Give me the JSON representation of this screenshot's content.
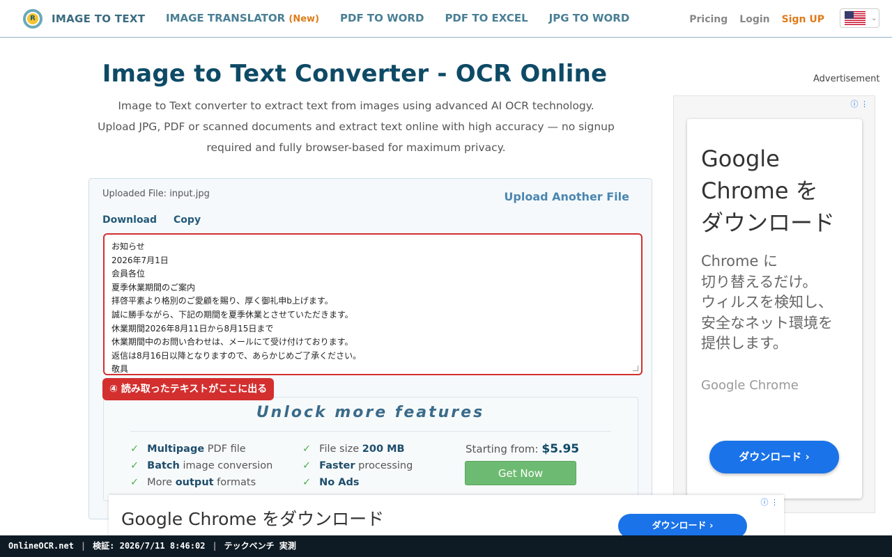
{
  "header": {
    "logo_text": "IMAGE TO TEXT",
    "nav": [
      {
        "label": "IMAGE TRANSLATOR",
        "tag": "(New)"
      },
      {
        "label": "PDF TO WORD"
      },
      {
        "label": "PDF TO EXCEL"
      },
      {
        "label": "JPG TO WORD"
      }
    ],
    "pricing": "Pricing",
    "login": "Login",
    "signup": "Sign UP"
  },
  "main": {
    "title": "Image to Text Converter - OCR Online",
    "description": "Image to Text converter to extract text from images using advanced AI OCR technology. Upload JPG, PDF or scanned documents and extract text online with high accuracy — no signup required and fully browser-based for maximum privacy.",
    "uploaded_file": "Uploaded File: input.jpg",
    "upload_another": "Upload Another File",
    "download": "Download",
    "copy": "Copy",
    "result_lines": [
      "お知らせ",
      "2026年7月1日",
      "会員各位",
      "夏季休業期間のご案内",
      "拝啓平素より格別のご愛顧を賜り、厚く御礼申b上げます。",
      "誠に勝手ながら、下記の期間を夏季休業とさせていただきます。",
      "休業期間2026年8月11日から8月15日まで",
      "休業期間中のお問い合わせは、メールにて受け付けております。",
      "返信は8月16日以降となりますので、あらかじめご了承ください。",
      "敬具"
    ],
    "annotation": "④ 読み取ったテキストがここに出る"
  },
  "features": {
    "title": "Unlock more features",
    "col1": [
      {
        "bold": "Multipage",
        "rest": " PDF file"
      },
      {
        "bold": "Batch",
        "rest": " image conversion"
      },
      {
        "pre": "More ",
        "bold": "output",
        "rest": " formats"
      }
    ],
    "col2": [
      {
        "pre": "File size ",
        "bold": "200 MB"
      },
      {
        "bold": "Faster",
        "rest": " processing"
      },
      {
        "bold": "No Ads"
      }
    ],
    "price_label": "Starting from:",
    "price_value": "$5.95",
    "get_now": "Get Now"
  },
  "side_ad": {
    "label": "Advertisement",
    "headline_lines": [
      "Google",
      "Chrome を",
      "ダウンロード"
    ],
    "body_lines": [
      "Chrome に",
      "切り替えるだけ。",
      "ウィルスを検知し、",
      "安全なネット環境を",
      "提供します。"
    ],
    "brand": "Google Chrome",
    "button": "ダウンロード ›"
  },
  "bottom_ad": {
    "headline": "Google Chrome をダウンロード",
    "button": "ダウンロード ›"
  },
  "status_bar": {
    "site": "OnlineOCR.net",
    "verified": "検証: 2026/7/11 8:46:02",
    "note": "テックベンチ 実測"
  },
  "colors": {
    "primary_title": "#0e4a66",
    "accent_orange": "#e07b1a",
    "annotation_red": "#d32f2f",
    "get_now_green": "#6dbb72",
    "ad_blue": "#1a73e8"
  }
}
